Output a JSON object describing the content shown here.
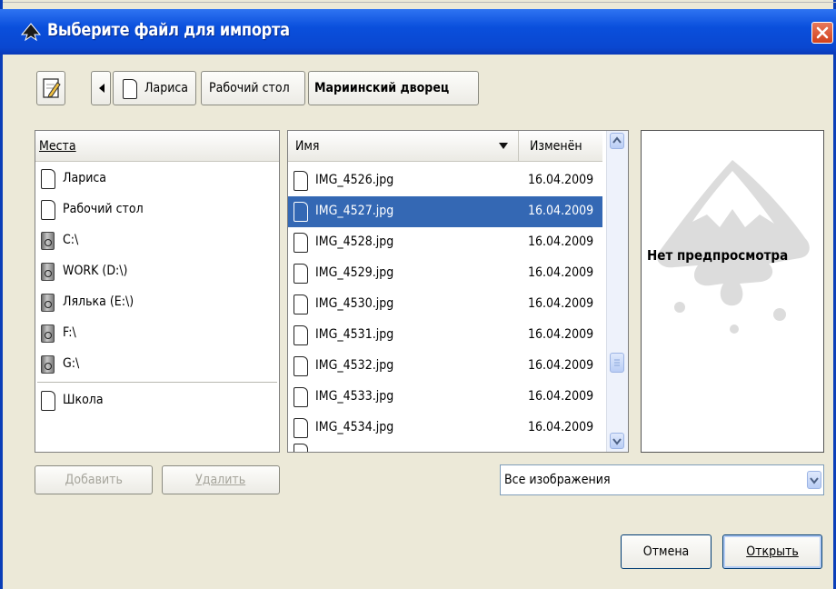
{
  "window": {
    "title": "Выберите файл для импорта",
    "title_bar_color": "#0a4fdc",
    "icons": {
      "app": "inkscape-icon",
      "close": "close-icon"
    }
  },
  "path_bar": {
    "edit_icon": "edit-location-icon",
    "back_icon": "left-arrow-icon",
    "crumbs": [
      {
        "label": "Лариса",
        "icon": "folder-icon"
      },
      {
        "label": "Рабочий стол"
      },
      {
        "label": "Мариинский дворец",
        "active": true
      }
    ]
  },
  "places": {
    "header": "Места",
    "items": [
      {
        "label": "Лариса",
        "icon": "folder-icon"
      },
      {
        "label": "Рабочий стол",
        "icon": "folder-icon"
      },
      {
        "label": "C:\\",
        "icon": "drive-icon"
      },
      {
        "label": "WORK (D:\\)",
        "icon": "drive-icon"
      },
      {
        "label": "Лялька (E:\\)",
        "icon": "drive-icon"
      },
      {
        "label": "F:\\",
        "icon": "drive-icon"
      },
      {
        "label": "G:\\",
        "icon": "drive-icon"
      },
      {
        "label": "Школа",
        "icon": "folder-icon"
      }
    ],
    "add_label": "Добавить",
    "remove_label": "Удалить"
  },
  "files": {
    "columns": {
      "name": "Имя",
      "modified": "Изменён"
    },
    "sort_icon": "sort-down-icon",
    "rows": [
      {
        "name": "IMG_4526.jpg",
        "date": "16.04.2009"
      },
      {
        "name": "IMG_4527.jpg",
        "date": "16.04.2009",
        "selected": true
      },
      {
        "name": "IMG_4528.jpg",
        "date": "16.04.2009"
      },
      {
        "name": "IMG_4529.jpg",
        "date": "16.04.2009"
      },
      {
        "name": "IMG_4530.jpg",
        "date": "16.04.2009"
      },
      {
        "name": "IMG_4531.jpg",
        "date": "16.04.2009"
      },
      {
        "name": "IMG_4532.jpg",
        "date": "16.04.2009"
      },
      {
        "name": "IMG_4533.jpg",
        "date": "16.04.2009"
      },
      {
        "name": "IMG_4534.jpg",
        "date": "16.04.2009"
      }
    ],
    "selection_color": "#3468b4"
  },
  "preview": {
    "label": "Нет предпросмотра",
    "placeholder_icon": "inkscape-logo-icon"
  },
  "filter": {
    "value": "Все изображения"
  },
  "buttons": {
    "cancel": "Отмена",
    "open": "Открыть"
  }
}
